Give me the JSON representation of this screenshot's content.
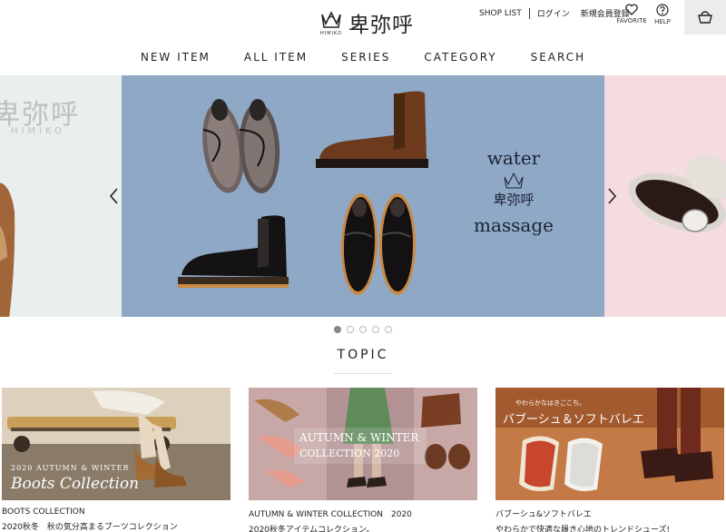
{
  "header": {
    "logo_text": "卑弥呼",
    "logo_sub": "HIMIKO",
    "util_links": [
      "SHOP LIST",
      "ログイン",
      "新規会員登録"
    ],
    "favorite_label": "FAVORITE",
    "help_label": "HELP"
  },
  "nav": {
    "items": [
      "NEW ITEM",
      "ALL ITEM",
      "SERIES",
      "CATEGORY",
      "SEARCH"
    ]
  },
  "carousel": {
    "left_slide_text": "卑弥呼",
    "left_slide_sub": "HIMIKO",
    "main_slide_ring_top": "water",
    "main_slide_ring_bottom": "massage",
    "main_slide_center": "卑弥呼",
    "slide_count": 5,
    "active_index": 0
  },
  "topic": {
    "title": "TOPIC",
    "cards": [
      {
        "img_line1": "2020 AUTUMN & WINTER",
        "img_line2": "Boots Collection",
        "title": "BOOTS COLLECTION",
        "subtitle": "2020秋冬　秋の気分高まるブーツコレクション"
      },
      {
        "img_line1": "AUTUMN & WINTER",
        "img_line2": "COLLECTION 2020",
        "title": "AUTUMN & WINTER COLLECTION　2020",
        "subtitle": "2020秋冬アイテムコレクション。"
      },
      {
        "img_line1": "やわらかなはきごこち。",
        "img_line2": "バブーシュ＆ソフトバレエ",
        "title": "バブーシュ&ソフトバレエ",
        "subtitle": "やわらかで快適な履き心地のトレンドシューズ!"
      }
    ]
  },
  "colors": {
    "main_slide_bg": "#8ea8c6",
    "cart_bg": "#ececec"
  }
}
